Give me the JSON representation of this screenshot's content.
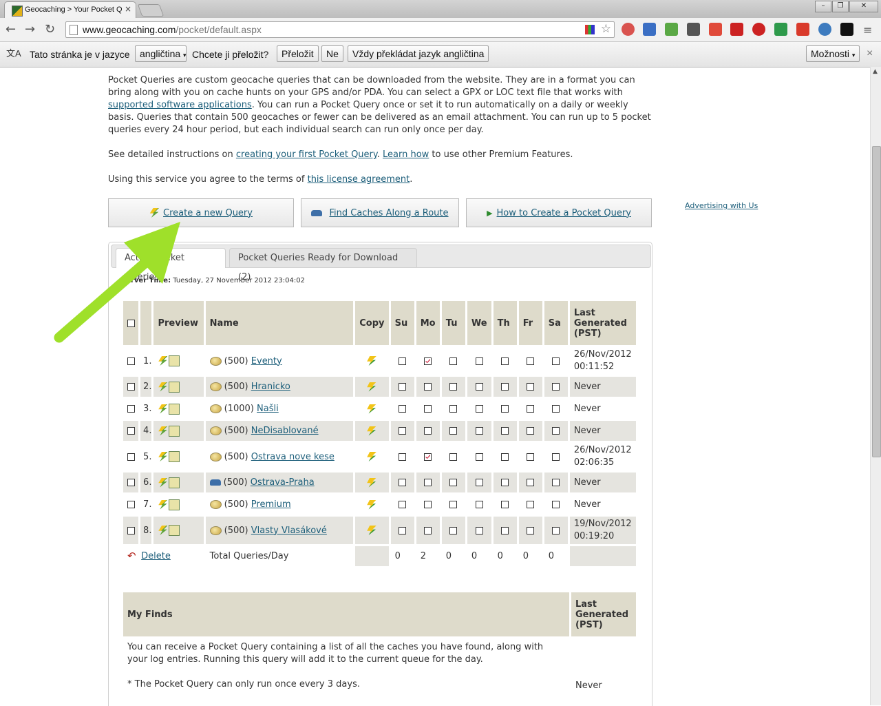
{
  "browser": {
    "tab_title": "Geocaching > Your Pocket Q",
    "tab_close": "×",
    "url_host": "www.geocaching.com",
    "url_path": "/pocket/default.aspx"
  },
  "translate_bar": {
    "prefix": "Tato stránka je v jazyce",
    "language": "angličtina",
    "question": "Chcete ji přeložit?",
    "translate_btn": "Přeložit",
    "no_btn": "Ne",
    "always_btn": "Vždy překládat jazyk angličtina",
    "options_btn": "Možnosti",
    "close": "×"
  },
  "intro": {
    "p1_a": "Pocket Queries are custom geocache queries that can be downloaded from the website. They are in a format you can bring along with you on cache hunts on your GPS and/or PDA. You can select a GPX or LOC text file that works with ",
    "p1_link": "supported software applications",
    "p1_b": ". You can run a Pocket Query once or set it to run automatically on a daily or weekly basis. Queries that contain 500 geocaches or fewer can be delivered as an email attachment. You can run up to 5 pocket queries every 24 hour period, but each individual search can run only once per day.",
    "p2_a": "See detailed instructions on ",
    "p2_link1": "creating your first Pocket Query",
    "p2_b": ". ",
    "p2_link2": "Learn how",
    "p2_c": " to use other Premium Features.",
    "p3_a": "Using this service you agree to the terms of ",
    "p3_link": "this license agreement",
    "p3_b": "."
  },
  "actions": {
    "create": "Create a new Query",
    "route": "Find Caches Along a Route",
    "howto": "How to Create a Pocket Query",
    "ad": "Advertising with Us"
  },
  "tabs": {
    "active": "Active Pocket Queries",
    "ready": "Pocket Queries Ready for Download (2)"
  },
  "server_time": {
    "label": "Server Time:",
    "value": "Tuesday, 27 November 2012 23:04:02"
  },
  "table": {
    "headers": {
      "preview": "Preview",
      "name": "Name",
      "copy": "Copy",
      "su": "Su",
      "mo": "Mo",
      "tu": "Tu",
      "we": "We",
      "th": "Th",
      "fr": "Fr",
      "sa": "Sa",
      "last_generated": "Last Generated (PST)"
    },
    "rows": [
      {
        "num": "1.",
        "count": "(500)",
        "name": "Eventy",
        "icon": "cache-icon",
        "mo": true,
        "last": "26/Nov/2012 00:11:52"
      },
      {
        "num": "2.",
        "count": "(500)",
        "name": "Hranicko",
        "icon": "cache-icon",
        "mo": false,
        "last": "Never"
      },
      {
        "num": "3.",
        "count": "(1000)",
        "name": "Našli",
        "icon": "cache-icon",
        "mo": false,
        "last": "Never"
      },
      {
        "num": "4.",
        "count": "(500)",
        "name": "NeDisablované",
        "icon": "cache-icon",
        "mo": false,
        "last": "Never"
      },
      {
        "num": "5.",
        "count": "(500)",
        "name": "Ostrava nove kese",
        "icon": "cache-icon",
        "mo": true,
        "last": "26/Nov/2012 02:06:35"
      },
      {
        "num": "6.",
        "count": "(500)",
        "name": "Ostrava-Praha",
        "icon": "car-icon",
        "mo": false,
        "last": "Never"
      },
      {
        "num": "7.",
        "count": "(500)",
        "name": "Premium",
        "icon": "cache-icon",
        "mo": false,
        "last": "Never"
      },
      {
        "num": "8.",
        "count": "(500)",
        "name": "Vlasty Vlasákové",
        "icon": "cache-icon",
        "mo": false,
        "last": "19/Nov/2012 00:19:20"
      }
    ],
    "footer": {
      "delete": "Delete",
      "total_label": "Total Queries/Day",
      "totals": [
        "0",
        "2",
        "0",
        "0",
        "0",
        "0",
        "0"
      ]
    }
  },
  "my_finds": {
    "title": "My Finds",
    "last_generated": "Last Generated (PST)",
    "desc": "You can receive a Pocket Query containing a list of all the caches you have found, along with your log entries. Running this query will add it to the current queue for the day.",
    "note": "* The Pocket Query can only run once every 3 days.",
    "last": "Never"
  },
  "colors": {
    "arrow": "#9fe02a",
    "link": "#1c5e7a",
    "header_bg": "#dedbcb",
    "row_alt": "#e5e4df"
  }
}
